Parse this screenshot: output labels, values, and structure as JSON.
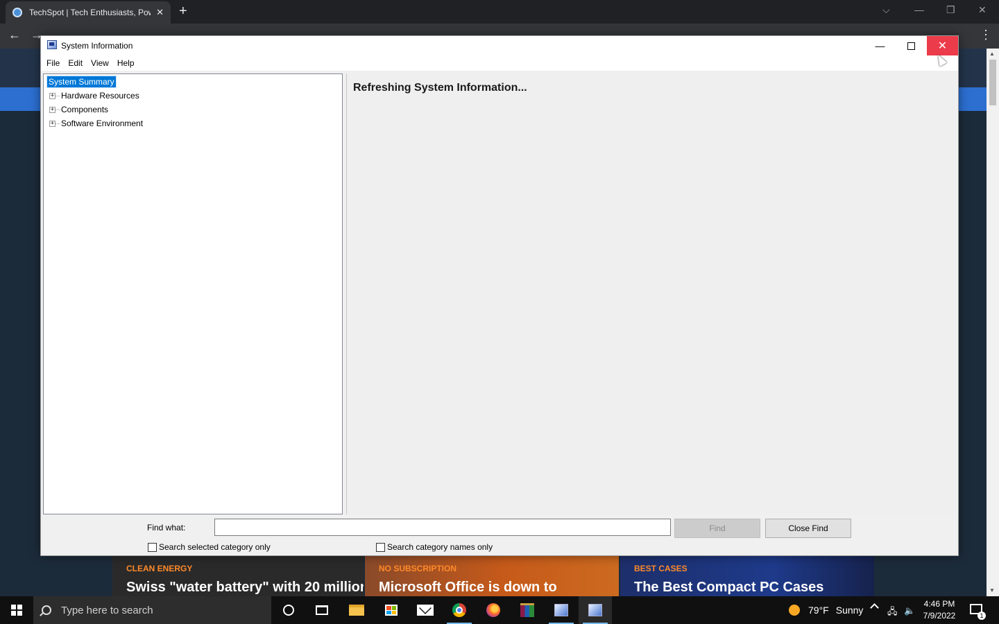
{
  "browser": {
    "tab_title": "TechSpot | Tech Enthusiasts, Pow",
    "new_tab": "+",
    "tab_close": "✕"
  },
  "page": {
    "cards": [
      {
        "kicker": "CLEAN ENERGY",
        "headline": "Swiss \"water battery\" with 20 million"
      },
      {
        "kicker": "NO SUBSCRIPTION",
        "headline": "Microsoft Office is down to"
      },
      {
        "kicker": "BEST CASES",
        "headline": "The Best Compact PC Cases"
      }
    ]
  },
  "window": {
    "title": "System Information",
    "menu": [
      "File",
      "Edit",
      "View",
      "Help"
    ],
    "tree": {
      "selected": "System Summary",
      "children": [
        "Hardware Resources",
        "Components",
        "Software Environment"
      ]
    },
    "status": "Refreshing System Information...",
    "find": {
      "label": "Find what:",
      "value": "",
      "find_button": "Find",
      "close_button": "Close Find",
      "check_selected": "Search selected category only",
      "check_names": "Search category names only"
    }
  },
  "taskbar": {
    "search_placeholder": "Type here to search",
    "weather_temp": "79°F",
    "weather_desc": "Sunny",
    "time": "4:46 PM",
    "date": "7/9/2022",
    "notification_count": "1"
  },
  "colors": {
    "selection": "#0078d7",
    "close_hover": "#e81123",
    "kicker": "#ff8a2a",
    "taskbar": "#101010"
  },
  "icons": {
    "tab": "techspot-favicon",
    "window": "system-information-icon",
    "tree_expander": "plus-box-icon",
    "start": "windows-logo-icon",
    "weather": "sun-icon"
  }
}
